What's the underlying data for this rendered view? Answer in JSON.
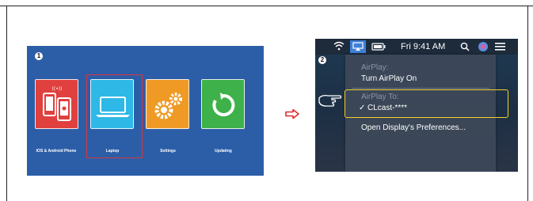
{
  "panel1": {
    "step_number": "1",
    "tiles": [
      {
        "label": "IOS & Android Phone",
        "icon": "phone-cast-icon",
        "color": "#e0403e"
      },
      {
        "label": "Laptop",
        "icon": "laptop-icon",
        "color": "#2db8e6"
      },
      {
        "label": "Settings",
        "icon": "gears-icon",
        "color": "#ef9a25"
      },
      {
        "label": "Updating",
        "icon": "refresh-icon",
        "color": "#3fb14a"
      }
    ],
    "highlight_color": "#d9363e"
  },
  "panel2": {
    "step_number": "2",
    "menubar": {
      "clock": "Fri 9:41 AM",
      "icons": [
        "wifi-icon",
        "airplay-icon",
        "battery-icon",
        "search-icon",
        "siri-icon",
        "list-icon"
      ]
    },
    "menu": {
      "airplay_header": "AirPlay:",
      "airplay_toggle": "Turn AirPlay On",
      "airplay_to_header": "AirPlay To:",
      "device_name": "CLcast-****",
      "checkmark": "✓",
      "preferences": "Open Display's Preferences..."
    },
    "highlight_color": "#f2d12c"
  },
  "arrow": "⇨"
}
